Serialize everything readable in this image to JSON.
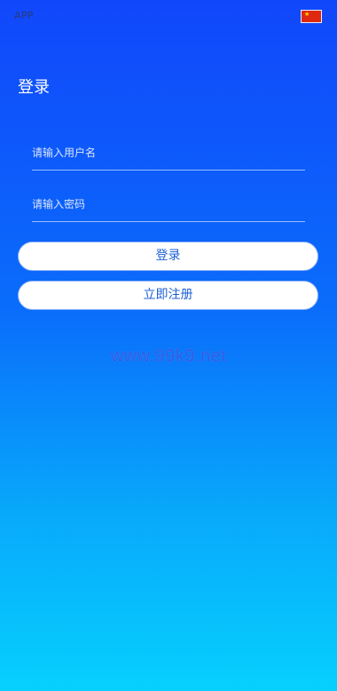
{
  "topbar": {
    "app_name": "APP",
    "language_flag_icon": "china-flag-icon"
  },
  "login": {
    "title": "登录",
    "username_placeholder": "请输入用户名",
    "username_value": "",
    "password_placeholder": "请输入密码",
    "password_value": "",
    "login_button_label": "登录",
    "register_button_label": "立即注册"
  },
  "watermark": {
    "text": "www.99k9.net"
  },
  "colors": {
    "gradient_top": "#1147fb",
    "gradient_bottom": "#06d0fd",
    "button_text": "#1c5fd6",
    "flag_red": "#de2910",
    "flag_star": "#ffde00"
  }
}
